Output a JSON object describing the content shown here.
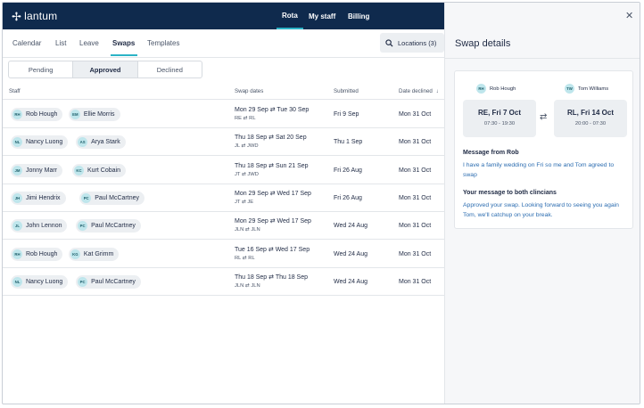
{
  "brand": {
    "name": "lantum"
  },
  "topnav": {
    "items": [
      "Rota",
      "My staff",
      "Billing"
    ],
    "active": "Rota"
  },
  "subnav": {
    "tabs": [
      "Calendar",
      "List",
      "Leave",
      "Swaps",
      "Templates"
    ],
    "active": "Swaps"
  },
  "locations_button": {
    "label": "Locations (3)"
  },
  "segments": {
    "options": [
      "Pending",
      "Approved",
      "Declined"
    ],
    "active": "Approved"
  },
  "table": {
    "headers": {
      "staff": "Staff",
      "swap_dates": "Swap dates",
      "submitted": "Submitted",
      "date_declined": "Date declined"
    },
    "rows": [
      {
        "a_initials": "RH",
        "a_name": "Rob Hough",
        "b_initials": "EM",
        "b_name": "Ellie Morris",
        "dates": "Mon 29 Sep ⇄ Tue 30 Sep",
        "codes": "RE ⇄ RL",
        "submitted": "Fri 9 Sep",
        "declined": "Mon 31 Oct"
      },
      {
        "a_initials": "NL",
        "a_name": "Nancy Luong",
        "b_initials": "AS",
        "b_name": "Arya Stark",
        "dates": "Thu 18 Sep ⇄ Sat 20 Sep",
        "codes": "JL ⇄ JWD",
        "submitted": "Thu 1 Sep",
        "declined": "Mon 31 Oct"
      },
      {
        "a_initials": "JM",
        "a_name": "Jonny Marr",
        "b_initials": "KC",
        "b_name": "Kurt Cobain",
        "dates": "Thu 18 Sep ⇄ Sun 21 Sep",
        "codes": "JT ⇄ JWD",
        "submitted": "Fri 26 Aug",
        "declined": "Mon 31 Oct"
      },
      {
        "a_initials": "JH",
        "a_name": "Jimi Hendrix",
        "b_initials": "PC",
        "b_name": "Paul McCartney",
        "dates": "Mon 29 Sep ⇄ Wed 17 Sep",
        "codes": "JT ⇄ JE",
        "submitted": "Fri 26 Aug",
        "declined": "Mon 31 Oct"
      },
      {
        "a_initials": "JL",
        "a_name": "John Lennon",
        "b_initials": "PC",
        "b_name": "Paul McCartney",
        "dates": "Mon 29 Sep ⇄ Wed 17 Sep",
        "codes": "JLN ⇄ JLN",
        "submitted": "Wed 24 Aug",
        "declined": "Mon 31 Oct"
      },
      {
        "a_initials": "RH",
        "a_name": "Rob Hough",
        "b_initials": "KG",
        "b_name": "Kat Grimm",
        "dates": "Tue 16 Sep ⇄ Wed 17 Sep",
        "codes": "RL ⇄ RL",
        "submitted": "Wed 24 Aug",
        "declined": "Mon 31 Oct"
      },
      {
        "a_initials": "NL",
        "a_name": "Nancy Luong",
        "b_initials": "PC",
        "b_name": "Paul McCartney",
        "dates": "Thu 18 Sep ⇄ Thu 18 Sep",
        "codes": "JLN ⇄ JLN",
        "submitted": "Wed 24 Aug",
        "declined": "Mon 31 Oct"
      }
    ]
  },
  "panel": {
    "title": "Swap details",
    "from": {
      "initials": "RH",
      "name": "Rob Hough",
      "shift": "RE, Fri 7 Oct",
      "hours": "07:30 - 19:30"
    },
    "to": {
      "initials": "TW",
      "name": "Tom Williams",
      "shift": "RL, Fri 14 Oct",
      "hours": "20:00 - 07:30"
    },
    "message_from_heading": "Message from Rob",
    "message_from_body": "I have a family wedding on Fri so me and Tom agreed to swap",
    "message_to_heading": "Your message to both clincians",
    "message_to_body": "Approved your swap. Looking forward to seeing you again Tom, we'll catchup on your break."
  },
  "colors": {
    "topbar": "#0f2a4d",
    "accent": "#2cb3c6",
    "link_text": "#2b6cb0"
  },
  "icons": {
    "brand": "lantum-star-icon",
    "search": "search-icon",
    "close": "close-icon",
    "swap": "swap-arrows-icon",
    "sort": "sort-arrow-down-icon"
  }
}
